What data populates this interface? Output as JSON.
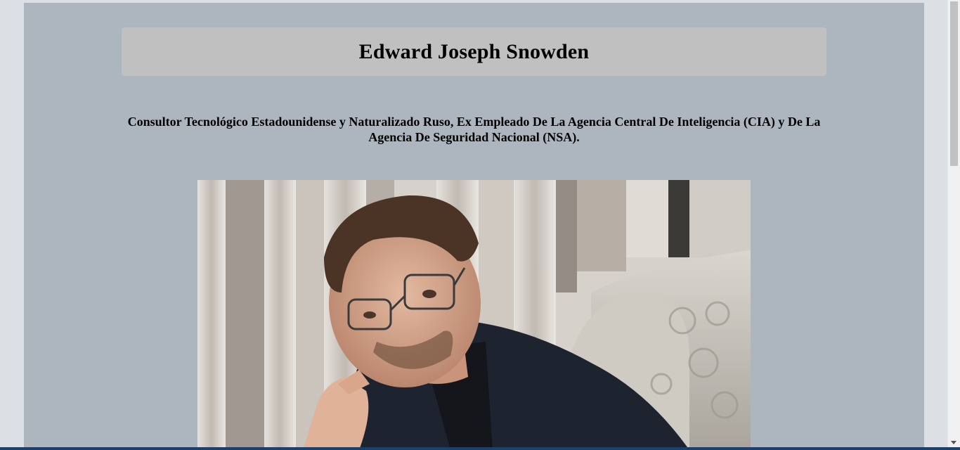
{
  "page": {
    "title": "Edward Joseph Snowden",
    "subtitle": "Consultor Tecnológico Estadounidense y Naturalizado Ruso, Ex Empleado De La Agencia Central De Inteligencia (CIA) y De La Agencia De Seguridad Nacional (NSA).",
    "photo_alt": "Edward Joseph Snowden"
  },
  "colors": {
    "page_background": "#adb5bf",
    "outer_background": "#dce0e5",
    "title_box": "#c0c0c0",
    "text": "#000000"
  }
}
